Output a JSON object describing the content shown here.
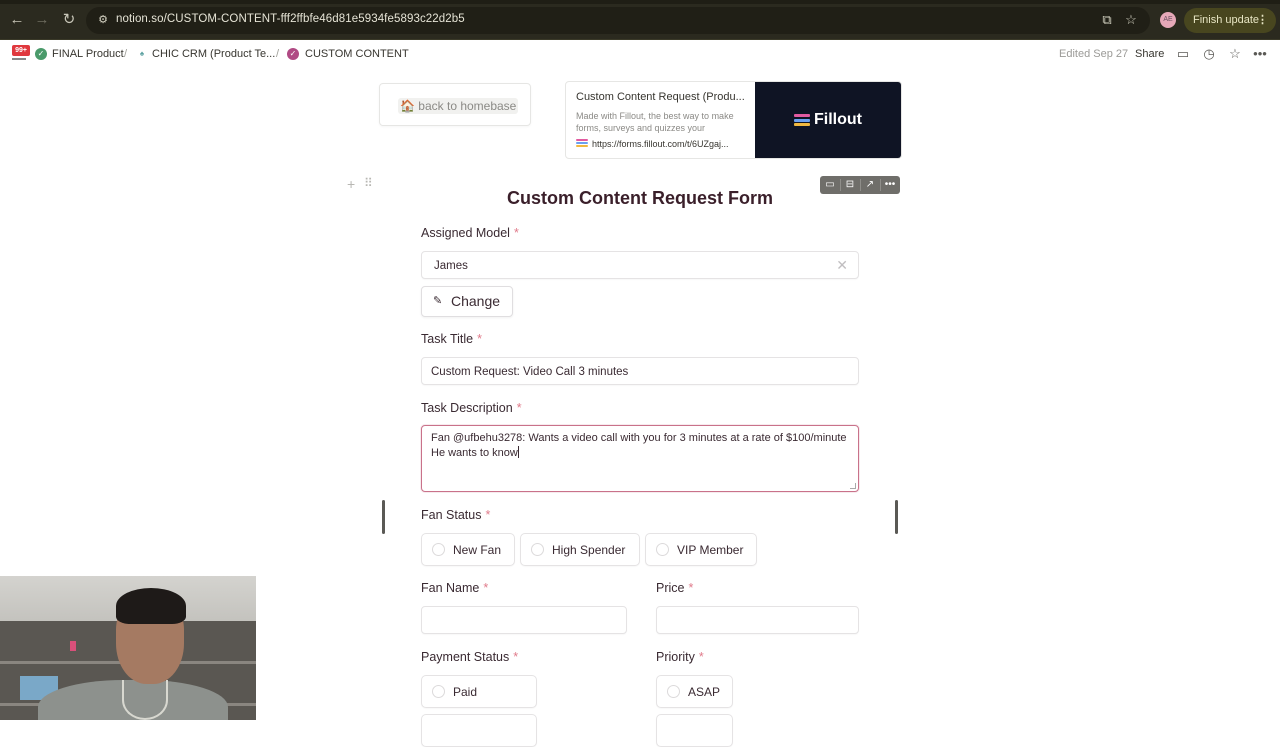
{
  "browser": {
    "url": "notion.so/CUSTOM-CONTENT-fff2ffbfe46d81e5934fe5893c22d2b5",
    "finish_update_label": "Finish update",
    "profile_initials": "AE"
  },
  "notion": {
    "notification_badge": "99+",
    "breadcrumbs": [
      {
        "label": "FINAL Product",
        "icon": "check-badge-icon"
      },
      {
        "label": "CHIC CRM (Product Te...",
        "icon": "crm-icon"
      },
      {
        "label": "CUSTOM CONTENT",
        "icon": "check-badge-icon"
      }
    ],
    "edited": "Edited Sep 27",
    "share_label": "Share"
  },
  "page": {
    "back_button": {
      "emoji": "🏠",
      "label": "back to homebase"
    },
    "bookmark": {
      "title": "Custom Content Request (Produ...",
      "description": "Made with Fillout, the best way to make forms, surveys and quizzes your",
      "url": "https://forms.fillout.com/t/6UZgaj...",
      "image_label": "Fillout",
      "logo_colors": [
        "#e25aa0",
        "#6aa0f0",
        "#f0b840"
      ]
    }
  },
  "form": {
    "title": "Custom Content Request Form",
    "required_mark": "*",
    "assigned_model": {
      "label": "Assigned Model",
      "value": "James",
      "change_label": "Change"
    },
    "task_title": {
      "label": "Task Title",
      "value": "Custom Request: Video Call 3 minutes"
    },
    "task_description": {
      "label": "Task Description",
      "value": "Fan @ufbehu3278: Wants a video call with you for 3 minutes at a rate of $100/minute\nHe wants to know"
    },
    "fan_status": {
      "label": "Fan Status",
      "options": [
        "New Fan",
        "High Spender",
        "VIP Member"
      ]
    },
    "fan_name": {
      "label": "Fan Name",
      "value": ""
    },
    "price": {
      "label": "Price",
      "value": ""
    },
    "payment_status": {
      "label": "Payment Status",
      "options": [
        "Paid"
      ]
    },
    "priority": {
      "label": "Priority",
      "options": [
        "ASAP"
      ]
    }
  }
}
